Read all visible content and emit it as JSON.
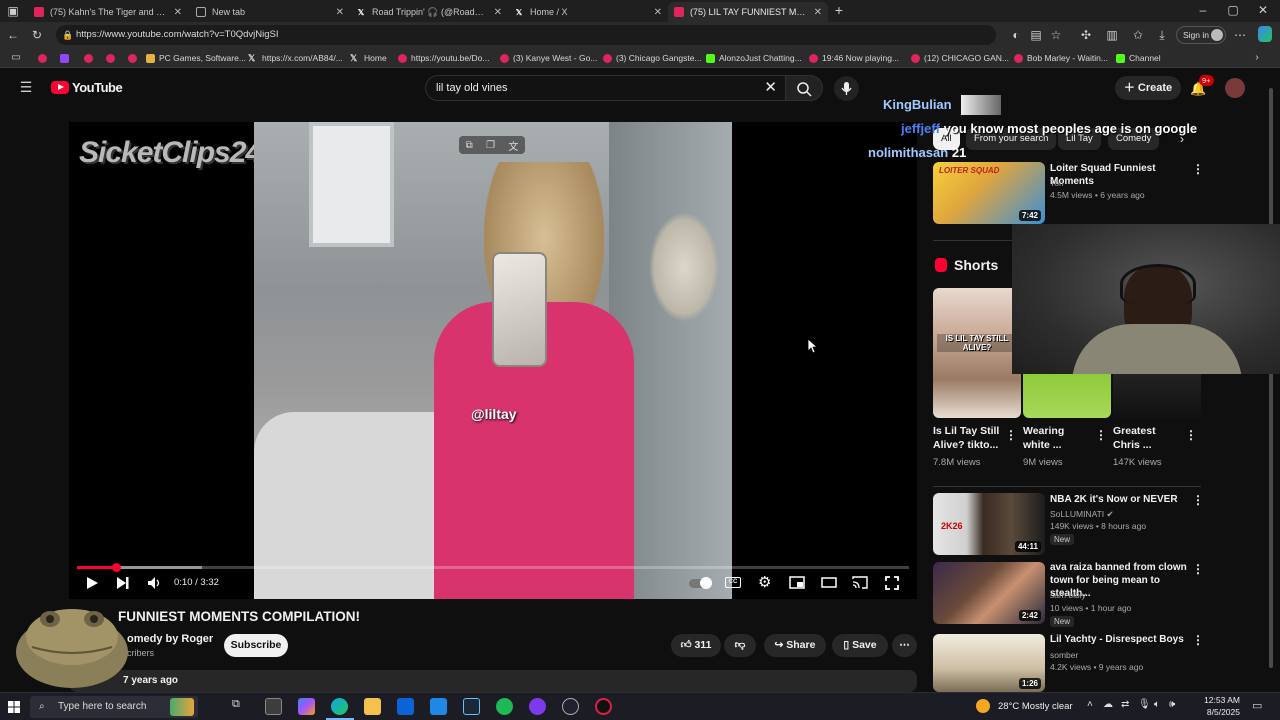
{
  "browser": {
    "tabs": [
      {
        "label": "(75) Kahn's The Tiger and the Stra",
        "icon": "youtube-icon"
      },
      {
        "label": "New tab",
        "icon": "newtab-icon"
      },
      {
        "label": "Road Trippin' 🎧 (@RoadTrippinP",
        "icon": "x-icon"
      },
      {
        "label": "Home / X",
        "icon": "x-icon"
      },
      {
        "label": "(75) LIL TAY FUNNIEST MOMENT",
        "icon": "youtube-icon"
      }
    ],
    "url": "https://www.youtube.com/watch?v=T0QdvjNigSI",
    "sign_in": "Sign in",
    "bookmarks": [
      {
        "label": "",
        "type": "yt"
      },
      {
        "label": "",
        "type": "twitch"
      },
      {
        "label": "PC Games, Software...",
        "type": "folder"
      },
      {
        "label": "https://x.com/AB84/...",
        "type": "x"
      },
      {
        "label": "Home",
        "type": "x"
      },
      {
        "label": "https://youtu.be/Do...",
        "type": "yt"
      },
      {
        "label": "(3) Kanye West - Go...",
        "type": "yt"
      },
      {
        "label": "(3) Chicago Gangste...",
        "type": "yt"
      },
      {
        "label": "AlonzoJust Chatting...",
        "type": "kick"
      },
      {
        "label": "19:46 Now playing...",
        "type": "yt"
      },
      {
        "label": "(12) CHICAGO GAN...",
        "type": "yt"
      },
      {
        "label": "Bob Marley - Waitin...",
        "type": "yt"
      },
      {
        "label": "Channel",
        "type": "kick"
      }
    ]
  },
  "youtube": {
    "logo": "YouTube",
    "search_value": "lil tay old vines",
    "create": "Create",
    "notif_count": "9+"
  },
  "player": {
    "watermark": "SicketClips247",
    "overlay_handle": "@liltay",
    "time": "0:10 / 3:32",
    "progress": 0.047,
    "buffered": 0.15
  },
  "video": {
    "title": "FUNNIEST MOMENTS COMPILATION!",
    "channel": "omedy by Roger",
    "subs": "cribers",
    "subscribe": "Subscribe",
    "likes": "311",
    "share": "Share",
    "save": "Save",
    "age": "7 years ago"
  },
  "chat": [
    {
      "user": "KingBulian",
      "msg": "",
      "user_color": "#9ecbff"
    },
    {
      "user": "jeffjeff",
      "msg": "you know most peoples age is on google",
      "user_color": "#4f7ff5"
    },
    {
      "user": "nolimithasan",
      "msg": "21",
      "user_color": "#9ecbff"
    }
  ],
  "sidebar": {
    "chips": [
      "All",
      "From your search",
      "Lil Tay",
      "Comedy"
    ],
    "top_video": {
      "title": "Loiter Squad Funniest Moments",
      "channel": "Tori",
      "meta": "4.5M views • 6 years ago",
      "duration": "7:42",
      "thumb_text": "LOITER SQUAD"
    },
    "shorts_label": "Shorts",
    "shorts": [
      {
        "title_l1": "Is Lil Tay Still",
        "title_l2": "Alive? tikto...",
        "views": "7.8M views",
        "thumb_text": "IS LIL TAY STILL ALIVE?"
      },
      {
        "title_l1": "Wearing",
        "title_l2": "white ...",
        "views": "9M views"
      },
      {
        "title_l1": "Greatest",
        "title_l2": "Chris ...",
        "views": "147K views"
      }
    ],
    "videos": [
      {
        "title": "NBA 2K it's Now or NEVER",
        "channel": "SoLLUMINATI",
        "verified": true,
        "meta": "149K views • 8 hours ago",
        "badge": "New",
        "duration": "44:11",
        "thumb_text": "2K26"
      },
      {
        "title": "ava raiza banned from clown town for being mean to stealth...",
        "channel": "sam bibly",
        "meta": "10 views • 1 hour ago",
        "badge": "New",
        "duration": "2:42"
      },
      {
        "title": "Lil Yachty - Disrespect Boys",
        "channel": "somber",
        "meta": "4.2K views • 9 years ago",
        "duration": "1:26"
      }
    ]
  },
  "taskbar": {
    "search_placeholder": "Type here to search",
    "weather": "28°C  Mostly clear",
    "time": "12:53 AM",
    "date": "8/5/2025"
  },
  "colors": {
    "accent": "#ff0033",
    "bg": "#0f0f0f",
    "chip": "#272727",
    "text": "#f1f1f1"
  }
}
